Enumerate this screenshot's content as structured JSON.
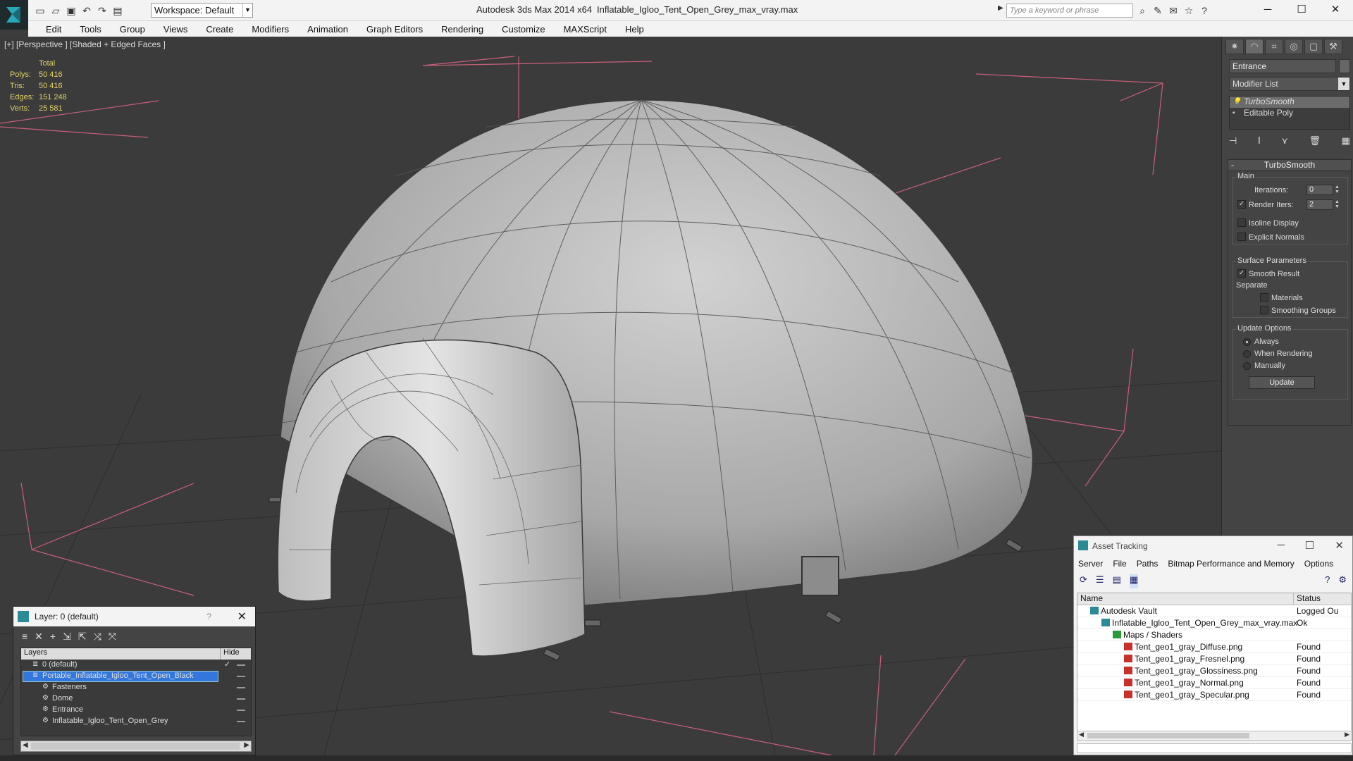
{
  "window": {
    "app_title": "Autodesk 3ds Max  2014 x64",
    "file_title": "Inflatable_Igloo_Tent_Open_Grey_max_vray.max",
    "workspace": "Workspace: Default",
    "search_placeholder": "Type a keyword or phrase"
  },
  "menu": [
    "Edit",
    "Tools",
    "Group",
    "Views",
    "Create",
    "Modifiers",
    "Animation",
    "Graph Editors",
    "Rendering",
    "Customize",
    "MAXScript",
    "Help"
  ],
  "viewport": {
    "label": "[+] [Perspective ] [Shaded + Edged Faces ]",
    "stats": {
      "header": "Total",
      "rows": [
        {
          "k": "Polys:",
          "v": "50 416"
        },
        {
          "k": "Tris:",
          "v": "50 416"
        },
        {
          "k": "Edges:",
          "v": "151 248"
        },
        {
          "k": "Verts:",
          "v": "25 581"
        }
      ]
    }
  },
  "command_panel": {
    "object_name": "Entrance",
    "modifier_list": "Modifier List",
    "stack": [
      "TurboSmooth",
      "Editable Poly"
    ],
    "rollout_title": "TurboSmooth",
    "main_group": "Main",
    "iterations_label": "Iterations:",
    "iterations_value": "0",
    "render_iters_label": "Render Iters:",
    "render_iters_value": "2",
    "render_iters_checked": true,
    "isoline_display": "Isoline Display",
    "explicit_normals": "Explicit Normals",
    "surface_group": "Surface Parameters",
    "smooth_result": "Smooth Result",
    "separate": "Separate",
    "materials": "Materials",
    "smoothing_groups": "Smoothing Groups",
    "update_group": "Update Options",
    "always": "Always",
    "when_rendering": "When Rendering",
    "manually": "Manually",
    "update_button": "Update"
  },
  "layer_explorer": {
    "title": "Layer: 0 (default)",
    "help": "?",
    "col_layers": "Layers",
    "col_hide": "Hide",
    "rows": [
      {
        "name": "0 (default)",
        "indent": 0,
        "kind": "layer",
        "check": true,
        "selected": false
      },
      {
        "name": "Portable_Inflatable_Igloo_Tent_Open_Black",
        "indent": 0,
        "kind": "layer",
        "check": false,
        "selected": true
      },
      {
        "name": "Fasteners",
        "indent": 1,
        "kind": "object",
        "check": false,
        "selected": false
      },
      {
        "name": "Dome",
        "indent": 1,
        "kind": "object",
        "check": false,
        "selected": false
      },
      {
        "name": "Entrance",
        "indent": 1,
        "kind": "object",
        "check": false,
        "selected": false
      },
      {
        "name": "Inflatable_Igloo_Tent_Open_Grey",
        "indent": 1,
        "kind": "object",
        "check": false,
        "selected": false
      }
    ]
  },
  "asset_tracking": {
    "title": "Asset Tracking",
    "menu": [
      "Server",
      "File",
      "Paths",
      "Bitmap Performance and Memory",
      "Options"
    ],
    "col_name": "Name",
    "col_status": "Status",
    "rows": [
      {
        "name": "Autodesk Vault",
        "status": "Logged Ou",
        "indent": 0,
        "icon": "vault-icon"
      },
      {
        "name": "Inflatable_Igloo_Tent_Open_Grey_max_vray.max",
        "status": "Ok",
        "indent": 1,
        "icon": "max-file-icon"
      },
      {
        "name": "Maps / Shaders",
        "status": "",
        "indent": 2,
        "icon": "maps-icon"
      },
      {
        "name": "Tent_geo1_gray_Diffuse.png",
        "status": "Found",
        "indent": 3,
        "icon": "png-icon"
      },
      {
        "name": "Tent_geo1_gray_Fresnel.png",
        "status": "Found",
        "indent": 3,
        "icon": "png-icon"
      },
      {
        "name": "Tent_geo1_gray_Glossiness.png",
        "status": "Found",
        "indent": 3,
        "icon": "png-icon"
      },
      {
        "name": "Tent_geo1_gray_Normal.png",
        "status": "Found",
        "indent": 3,
        "icon": "png-icon"
      },
      {
        "name": "Tent_geo1_gray_Specular.png",
        "status": "Found",
        "indent": 3,
        "icon": "png-icon"
      }
    ]
  },
  "colors": {
    "viewport_bg": "#3b3b3b",
    "stats_text": "#e0d36a",
    "bbox_lines": "#c8607a",
    "selection": "#3377dd"
  }
}
